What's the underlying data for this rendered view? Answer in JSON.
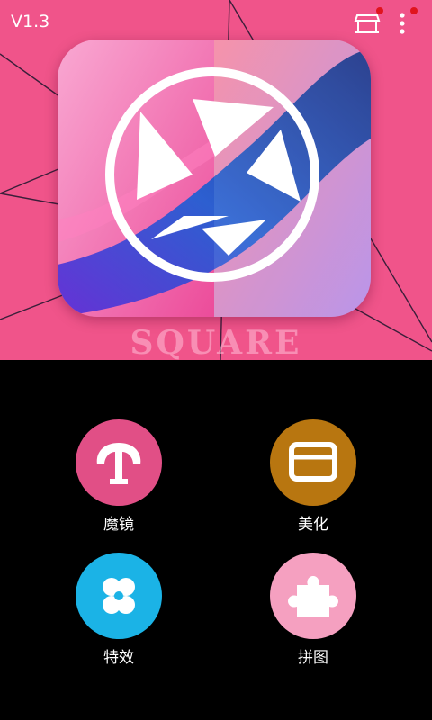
{
  "app": {
    "version": "V1.3",
    "logo_watermark": "SQUARE"
  },
  "top_bar": {
    "store_icon": "store-icon",
    "menu_icon": "more-vertical-icon"
  },
  "colors": {
    "hero_background": "#f0548a",
    "background": "#000000",
    "badge": "#e0141e"
  },
  "features": [
    {
      "label": "魔镜",
      "icon": "mirror-face-icon",
      "color": "#e14f86"
    },
    {
      "label": "美化",
      "icon": "beautify-frame-icon",
      "color": "#b87610"
    },
    {
      "label": "特效",
      "icon": "clover-icon",
      "color": "#1bb3e6"
    },
    {
      "label": "拼图",
      "icon": "puzzle-piece-icon",
      "color": "#f5a0c0"
    }
  ]
}
